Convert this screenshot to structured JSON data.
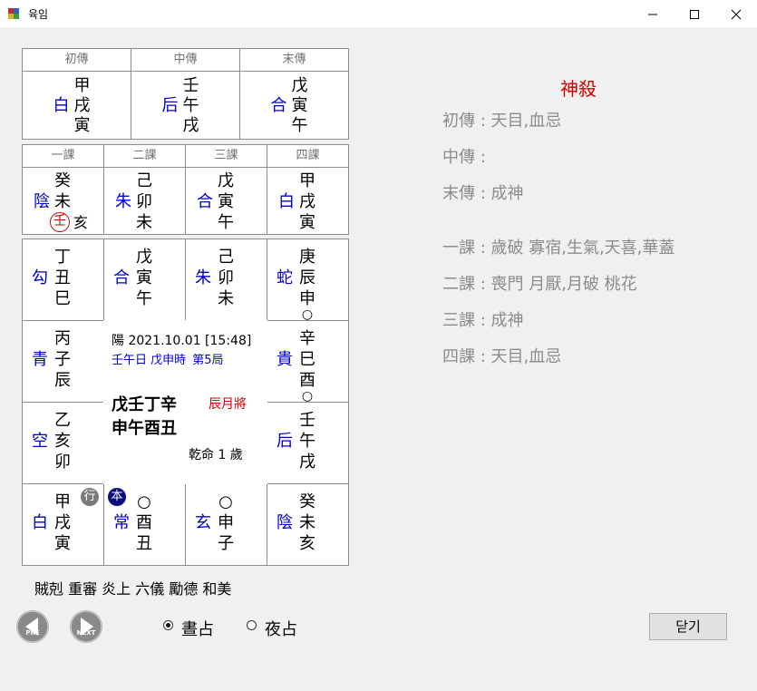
{
  "window": {
    "title": "육임"
  },
  "transmissions": {
    "headers": [
      "初傳",
      "中傳",
      "末傳"
    ],
    "cols": [
      {
        "general": "白",
        "top": "甲",
        "mid": "戌",
        "bot": "寅"
      },
      {
        "general": "后",
        "top": "壬",
        "mid": "午",
        "bot": "戌"
      },
      {
        "general": "合",
        "top": "戊",
        "mid": "寅",
        "bot": "午"
      }
    ]
  },
  "lessons": {
    "headers": [
      "一課",
      "二課",
      "三課",
      "四課"
    ],
    "cols": [
      {
        "general": "陰",
        "top": "癸",
        "mid": "未",
        "bot": "壬",
        "extra": "亥"
      },
      {
        "general": "朱",
        "top": "己",
        "mid": "卯",
        "bot": "未"
      },
      {
        "general": "合",
        "top": "戊",
        "mid": "寅",
        "bot": "午"
      },
      {
        "general": "白",
        "top": "甲",
        "mid": "戌",
        "bot": "寅"
      }
    ]
  },
  "board": {
    "top": [
      {
        "general": "勾",
        "a": "丁",
        "b": "丑",
        "c": "巳"
      },
      {
        "general": "合",
        "a": "戊",
        "b": "寅",
        "c": "午"
      },
      {
        "general": "朱",
        "a": "己",
        "b": "卯",
        "c": "未"
      },
      {
        "general": "蛇",
        "a": "庚",
        "b": "辰",
        "c": "申",
        "d": "○"
      }
    ],
    "left": [
      {
        "general": "青",
        "a": "丙",
        "b": "子",
        "c": "辰"
      },
      {
        "general": "空",
        "a": "乙",
        "b": "亥",
        "c": "卯"
      }
    ],
    "right": [
      {
        "general": "貴",
        "a": "辛",
        "b": "巳",
        "c": "酉",
        "d": "○"
      },
      {
        "general": "后",
        "a": "壬",
        "b": "午",
        "c": "戌"
      }
    ],
    "bottom": [
      {
        "general": "白",
        "a": "甲",
        "b": "戌",
        "c": "寅",
        "badge": "行"
      },
      {
        "general": "常",
        "a": "○",
        "b": "酉",
        "c": "丑",
        "badge": "本"
      },
      {
        "general": "玄",
        "a": "○",
        "b": "申",
        "c": "子"
      },
      {
        "general": "陰",
        "a": "癸",
        "b": "未",
        "c": "亥"
      }
    ],
    "center": {
      "date": "陽 2021.10.01 [15:48]",
      "day": "壬午日 戊申時",
      "ju": "第5局",
      "stems": "戊壬丁辛",
      "branches": "申午酉丑",
      "general_label": "辰月將",
      "age": "乾命 1 歲"
    }
  },
  "pattern": "賊剋 重審 炎上 六儀 勵德 和美",
  "shensha": {
    "title": "神殺",
    "lines": [
      "初傳 :  天目,血忌",
      "中傳 :",
      "末傳 :  成神",
      "一課 : 歲破 寡宿,生氣,天喜,華蓋",
      "二課 : 喪門 月厭,月破 桃花",
      "三課 :  成神",
      "四課 :  天目,血忌"
    ]
  },
  "controls": {
    "pre": "PRE",
    "next": "NEXT",
    "day_label": "晝占",
    "night_label": "夜占",
    "selected": "day",
    "close_label": "닫기"
  },
  "colors": {
    "accent_blue": "#0000c8",
    "accent_red": "#d00000"
  }
}
